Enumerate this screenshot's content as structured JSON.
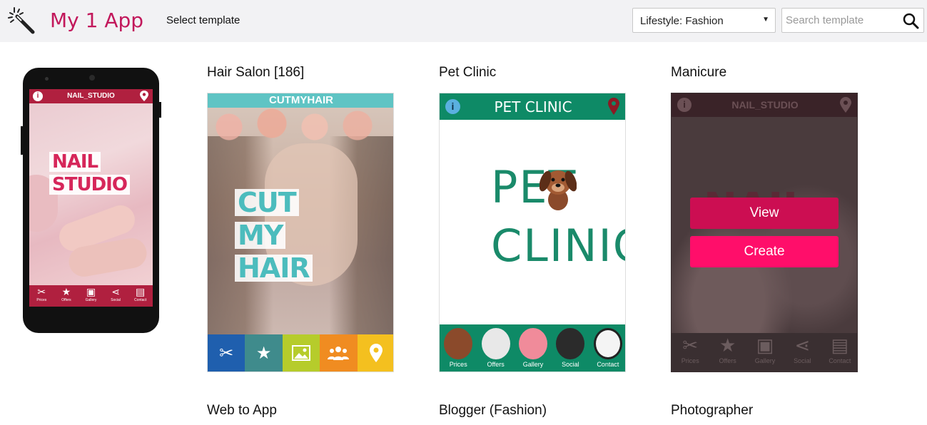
{
  "header": {
    "app_title": "My 1 App",
    "select_template_label": "Select template",
    "category_value": "Lifestyle: Fashion",
    "search_placeholder": "Search template"
  },
  "preview_phone": {
    "top_title": "NAIL_STUDIO",
    "line1": "NAIL",
    "line2": "STUDIO",
    "nav": [
      "Prices",
      "Offers",
      "Gallery",
      "Social",
      "Contact"
    ]
  },
  "templates": [
    {
      "title": "Hair Salon [186]",
      "header": "CUTMYHAIR",
      "words": [
        "CUT",
        "MY",
        "HAIR"
      ],
      "bar_colors": [
        "#1f5fae",
        "#3f8b8c",
        "#b6cc2b",
        "#f08c21",
        "#f4c01f"
      ]
    },
    {
      "title": "Pet Clinic",
      "header": "PET CLINIC",
      "line1": "PET",
      "line2": "CLINIC",
      "nav": [
        "Prices",
        "Offers",
        "Gallery",
        "Social",
        "Contact"
      ]
    },
    {
      "title": "Manicure",
      "header": "NAIL_STUDIO",
      "view_label": "View",
      "create_label": "Create",
      "nav": [
        "Prices",
        "Offers",
        "Gallery",
        "Social",
        "Contact"
      ]
    },
    {
      "title": "Web to App"
    },
    {
      "title": "Blogger (Fashion)"
    },
    {
      "title": "Photographer"
    }
  ],
  "colors": {
    "brand": "#c2185b",
    "view_button": "#cc0e52",
    "create_button": "#ff0e6a"
  }
}
